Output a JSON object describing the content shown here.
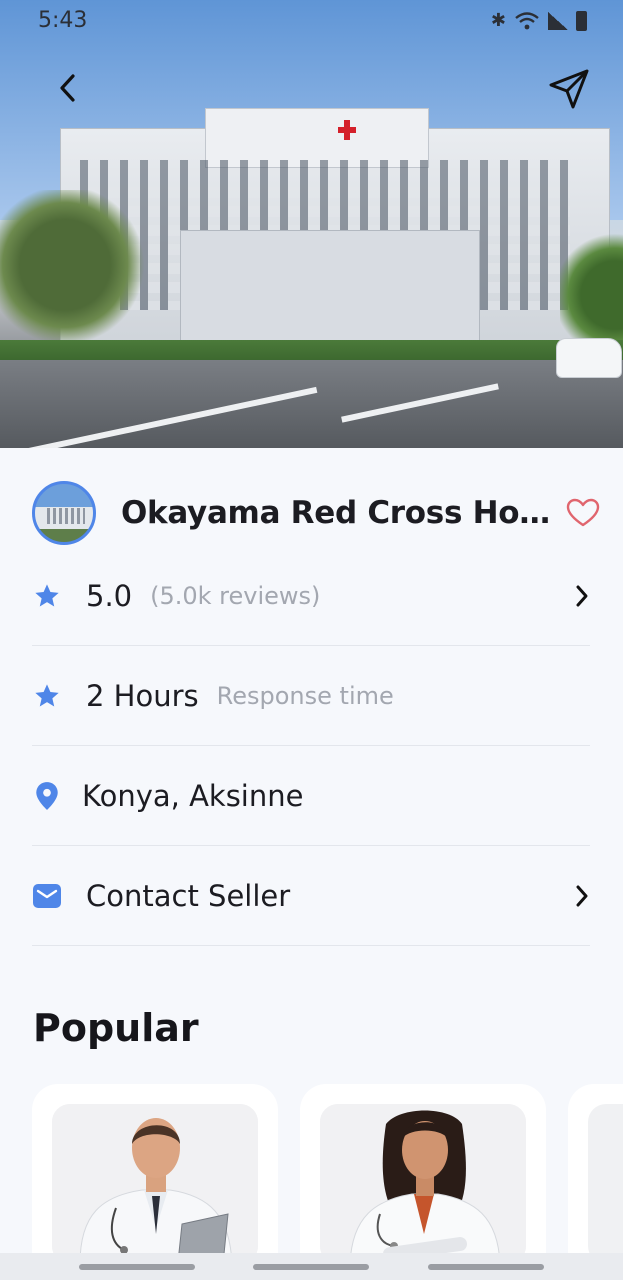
{
  "status_bar": {
    "time": "5:43"
  },
  "hospital": {
    "name": "Okayama Red Cross Hospi...",
    "rating": "5.0",
    "reviews": "(5.0k reviews)",
    "response_value": "2 Hours",
    "response_label": "Response time",
    "location": "Konya, Aksinne",
    "contact_label": "Contact Seller"
  },
  "popular": {
    "title": "Popular"
  },
  "colors": {
    "accent": "#4f86e8",
    "heart": "#e0656e",
    "muted_text": "#a3a7b0"
  }
}
